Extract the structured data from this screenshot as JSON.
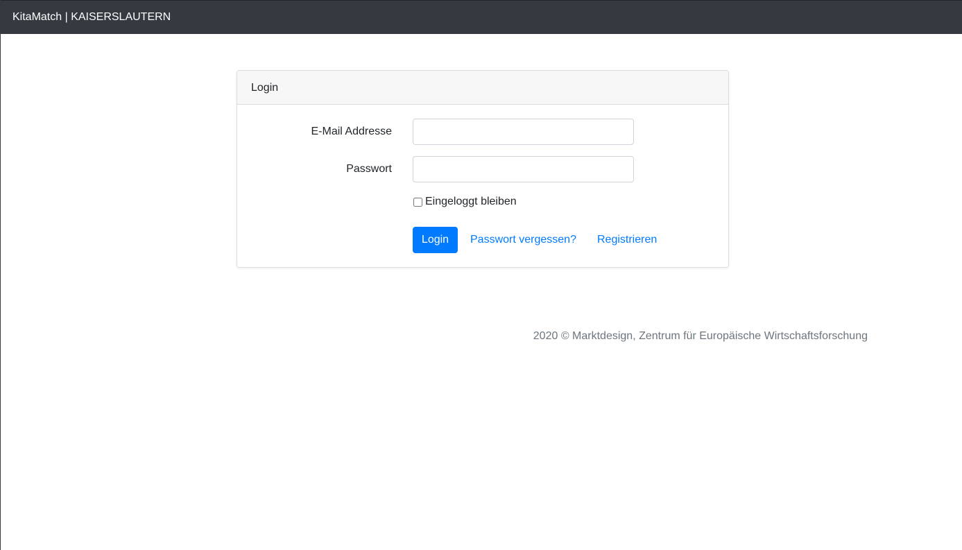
{
  "navbar": {
    "brand": "KitaMatch | KAISERSLAUTERN"
  },
  "login_card": {
    "title": "Login",
    "email_label": "E-Mail Addresse",
    "email_value": "",
    "password_label": "Passwort",
    "password_value": "",
    "remember_label": "Eingeloggt bleiben",
    "remember_checked": false,
    "login_button": "Login",
    "forgot_link": "Passwort vergessen?",
    "register_link": "Registrieren"
  },
  "footer": {
    "text": "2020 © Marktdesign, Zentrum für Europäische Wirtschaftsforschung"
  },
  "colors": {
    "navbar_bg": "#343a40",
    "primary": "#007bff",
    "muted_text": "#6c757d"
  }
}
